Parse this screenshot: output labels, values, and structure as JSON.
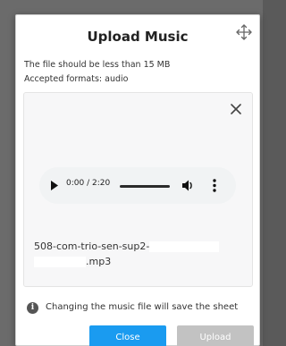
{
  "dialog": {
    "title": "Upload Music",
    "size_limit_text": "The file should be less than 15 MB",
    "formats_text": "Accepted formats: audio"
  },
  "player": {
    "time": "0:00 / 2:20"
  },
  "file": {
    "name_part1": "508-com-trio-sen-sup2-",
    "name_part2": ".mp3"
  },
  "notice": {
    "icon_glyph": "i",
    "text": "Changing the music file will save the sheet"
  },
  "buttons": {
    "close_label": "Close",
    "upload_label": "Upload"
  },
  "icons": {
    "move": "move-arrows-icon",
    "close": "close-icon",
    "play": "play-icon",
    "volume": "volume-icon",
    "more": "more-vertical-icon",
    "info": "info-icon"
  },
  "colors": {
    "primary": "#1a9bf0",
    "disabled": "#c2c2c2"
  }
}
